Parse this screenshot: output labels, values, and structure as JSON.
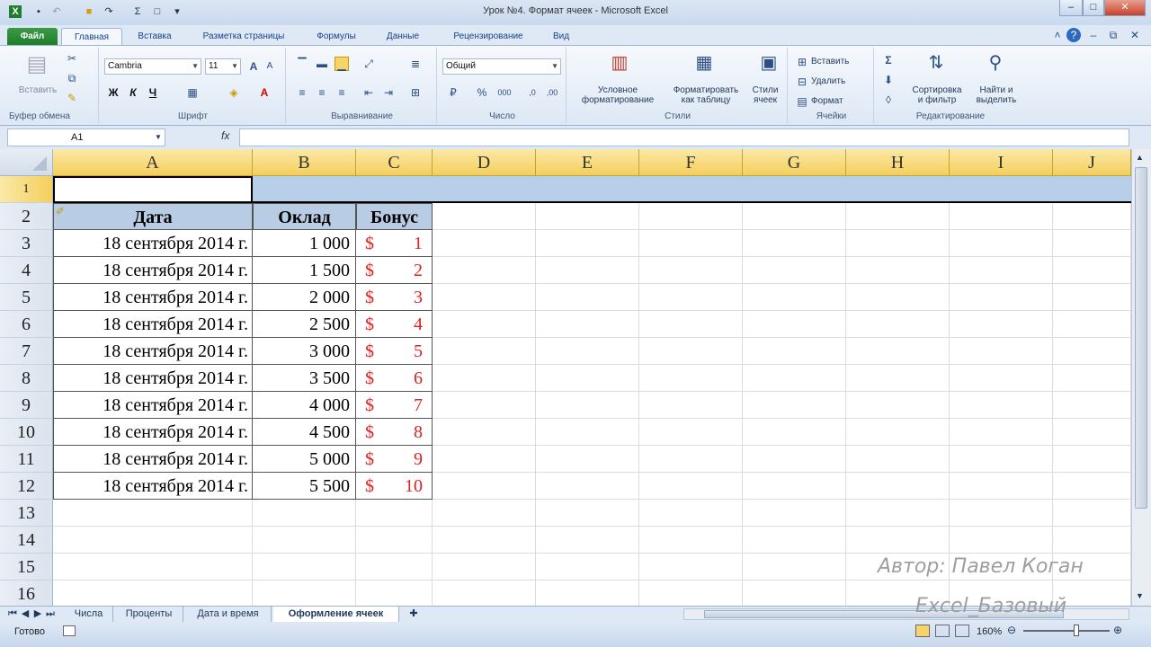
{
  "window": {
    "title": "Урок №4. Формат ячеек - Microsoft Excel"
  },
  "tabs": {
    "file": "Файл",
    "items": [
      "Главная",
      "Вставка",
      "Разметка страницы",
      "Формулы",
      "Данные",
      "Рецензирование",
      "Вид"
    ]
  },
  "ribbon": {
    "clipboard": {
      "paste": "Вставить",
      "label": "Буфер обмена"
    },
    "font": {
      "name": "Cambria",
      "size": "11",
      "bold": "Ж",
      "italic": "К",
      "underline": "Ч",
      "label": "Шрифт"
    },
    "alignment": {
      "label": "Выравнивание"
    },
    "number": {
      "format": "Общий",
      "percent": "%",
      "thousands": "000",
      "label": "Число"
    },
    "styles": {
      "conditional_1": "Условное",
      "conditional_2": "форматирование",
      "format_table_1": "Форматировать",
      "format_table_2": "как таблицу",
      "cell_styles_1": "Стили",
      "cell_styles_2": "ячеек",
      "label": "Стили"
    },
    "cells": {
      "insert": "Вставить",
      "delete": "Удалить",
      "format": "Формат",
      "label": "Ячейки"
    },
    "editing": {
      "sort_1": "Сортировка",
      "sort_2": "и фильтр",
      "find_1": "Найти и",
      "find_2": "выделить",
      "label": "Редактирование"
    }
  },
  "formula_bar": {
    "name_box": "A1",
    "fx": "fx",
    "value": ""
  },
  "columns": [
    "A",
    "B",
    "C",
    "D",
    "E",
    "F",
    "G",
    "H",
    "I",
    "J"
  ],
  "rows": [
    "1",
    "2",
    "3",
    "4",
    "5",
    "6",
    "7",
    "8",
    "9",
    "10",
    "11",
    "12",
    "13",
    "14",
    "15",
    "16"
  ],
  "table": {
    "headers": [
      "Дата",
      "Оклад",
      "Бонус"
    ],
    "rows": [
      {
        "date": "18 сентября 2014 г.",
        "salary": "1 000",
        "currency": "$",
        "bonus": "1"
      },
      {
        "date": "18 сентября 2014 г.",
        "salary": "1 500",
        "currency": "$",
        "bonus": "2"
      },
      {
        "date": "18 сентября 2014 г.",
        "salary": "2 000",
        "currency": "$",
        "bonus": "3"
      },
      {
        "date": "18 сентября 2014 г.",
        "salary": "2 500",
        "currency": "$",
        "bonus": "4"
      },
      {
        "date": "18 сентября 2014 г.",
        "salary": "3 000",
        "currency": "$",
        "bonus": "5"
      },
      {
        "date": "18 сентября 2014 г.",
        "salary": "3 500",
        "currency": "$",
        "bonus": "6"
      },
      {
        "date": "18 сентября 2014 г.",
        "salary": "4 000",
        "currency": "$",
        "bonus": "7"
      },
      {
        "date": "18 сентября 2014 г.",
        "salary": "4 500",
        "currency": "$",
        "bonus": "8"
      },
      {
        "date": "18 сентября 2014 г.",
        "salary": "5 000",
        "currency": "$",
        "bonus": "9"
      },
      {
        "date": "18 сентября 2014 г.",
        "salary": "5 500",
        "currency": "$",
        "bonus": "10"
      }
    ]
  },
  "sheet_tabs": [
    "Числа",
    "Проценты",
    "Дата и время",
    "Оформление ячеек"
  ],
  "status": {
    "ready": "Готово",
    "zoom": "160%"
  },
  "watermark": {
    "author": "Автор: Павел Коган",
    "course": "Excel_Базовый"
  },
  "colors": {
    "header_fill": "#b8cce4",
    "bonus_red": "#e02020",
    "col_header": "#f5cf5c"
  }
}
